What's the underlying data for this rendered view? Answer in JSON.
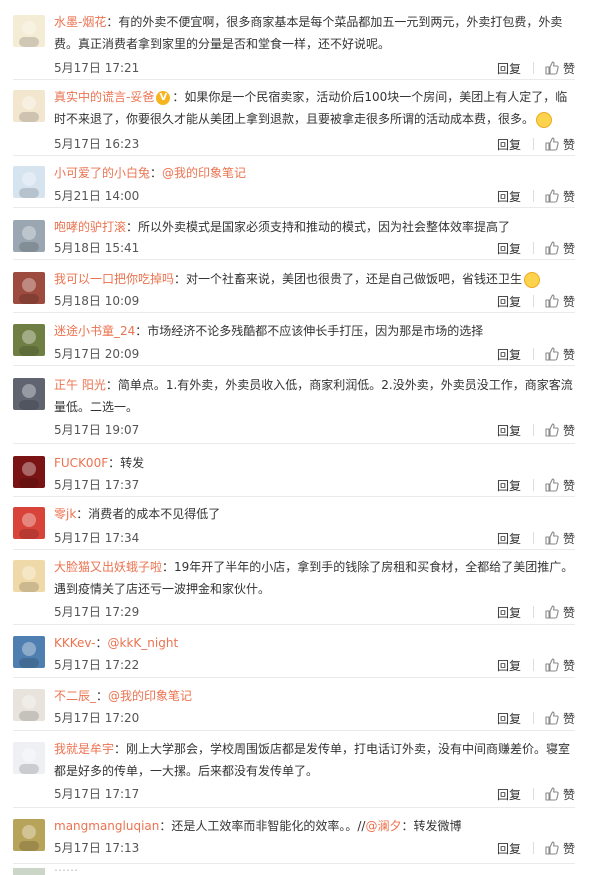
{
  "reply_label": "回复",
  "like_label": "赞",
  "comments": [
    {
      "name": "水墨-烟花",
      "badge": "",
      "vtext": "",
      "segments": [
        {
          "t": "text",
          "v": "：有的外卖不便宜啊，很多商家基本是每个菜品都加五一元到两元，外卖打包费，外卖费。真正消费者拿到家里的分量是否和堂食一样，还不好说呢。"
        }
      ],
      "time": "5月17日 17:21",
      "avatar": "#f5ecd5"
    },
    {
      "name": "真实中的谎言-妥爸",
      "badge": "V",
      "vtext": "",
      "segments": [
        {
          "t": "text",
          "v": "：如果你是一个民宿卖家，活动价后100块一个房间，美团上有人定了，临时不来退了，你要很久才能从美团上拿到退款，且要被拿走很多所谓的活动成本费，很多。"
        },
        {
          "t": "emoji"
        }
      ],
      "time": "5月17日 16:23",
      "avatar": "#f3e6cf"
    },
    {
      "name": "小可爱了的小白兔",
      "badge": "",
      "vtext": "",
      "segments": [
        {
          "t": "text",
          "v": "："
        },
        {
          "t": "mention",
          "v": "@我的印象笔记"
        }
      ],
      "time": "5月21日 14:00",
      "avatar": "#d6e4f0"
    },
    {
      "name": "咆哮的驴打滚",
      "badge": "",
      "vtext": "",
      "segments": [
        {
          "t": "text",
          "v": "：所以外卖模式是国家必须支持和推动的模式，因为社会整体效率提高了"
        }
      ],
      "time": "5月18日 15:41",
      "avatar": "#9aa6b1"
    },
    {
      "name": "我可以一口把你吃掉吗",
      "badge": "",
      "vtext": "",
      "segments": [
        {
          "t": "text",
          "v": "：对一个社畜来说，美团也很贵了，还是自己做饭吧，省钱还卫生"
        },
        {
          "t": "emoji"
        }
      ],
      "time": "5月18日 10:09",
      "avatar": "#9c4b3e"
    },
    {
      "name": "迷途小书童_24",
      "badge": "",
      "vtext": "",
      "segments": [
        {
          "t": "text",
          "v": "：市场经济不论多残酷都不应该伸长手打压，因为那是市场的选择"
        }
      ],
      "time": "5月17日 20:09",
      "avatar": "#6f7f44"
    },
    {
      "name": "正午 阳光",
      "badge": "",
      "vtext": "",
      "segments": [
        {
          "t": "text",
          "v": "：简单点。1.有外卖，外卖员收入低，商家利润低。2.没外卖，外卖员没工作，商家客流量低。二选一。"
        }
      ],
      "time": "5月17日 19:07",
      "avatar": "#5f6470"
    },
    {
      "name": "FUCK00F",
      "badge": "",
      "vtext": "",
      "segments": [
        {
          "t": "text",
          "v": "：转发"
        }
      ],
      "time": "5月17日 17:37",
      "avatar": "#7a1414"
    },
    {
      "name": "零jk",
      "badge": "",
      "vtext": "",
      "segments": [
        {
          "t": "text",
          "v": "：消费者的成本不见得低了"
        }
      ],
      "time": "5月17日 17:34",
      "avatar": "#d9443a"
    },
    {
      "name": "大脸猫又出妖蛾子啦",
      "badge": "",
      "vtext": "",
      "segments": [
        {
          "t": "text",
          "v": "：19年开了半年的小店，拿到手的钱除了房租和买食材，全都给了美团推广。遇到疫情关了店还亏一波押金和家伙什。"
        }
      ],
      "time": "5月17日 17:29",
      "avatar": "#f0d9a8"
    },
    {
      "name": "KKKev-",
      "badge": "",
      "vtext": "",
      "segments": [
        {
          "t": "text",
          "v": "："
        },
        {
          "t": "mention",
          "v": "@kkK_night"
        }
      ],
      "time": "5月17日 17:22",
      "avatar": "#4f7fb0"
    },
    {
      "name": "不二辰_",
      "badge": "",
      "vtext": "",
      "segments": [
        {
          "t": "text",
          "v": "："
        },
        {
          "t": "mention",
          "v": "@我的印象笔记"
        }
      ],
      "time": "5月17日 17:20",
      "avatar": "#e8e3dc"
    },
    {
      "name": "我就是牟宇",
      "badge": "",
      "vtext": "",
      "segments": [
        {
          "t": "text",
          "v": "：刚上大学那会，学校周围饭店都是发传单，打电话订外卖，没有中间商赚差价。寝室都是好多的传单，一大摞。后来都没有发传单了。"
        }
      ],
      "time": "5月17日 17:17",
      "avatar": "#eef0f4"
    },
    {
      "name": "mangmangluqian",
      "badge": "",
      "vtext": "",
      "segments": [
        {
          "t": "text",
          "v": "：还是人工效率而非智能化的效率。。//"
        },
        {
          "t": "mention",
          "v": "@澜夕"
        },
        {
          "t": "text",
          "v": "：转发微博"
        }
      ],
      "time": "5月17日 17:13",
      "avatar": "#b8a35a"
    }
  ]
}
